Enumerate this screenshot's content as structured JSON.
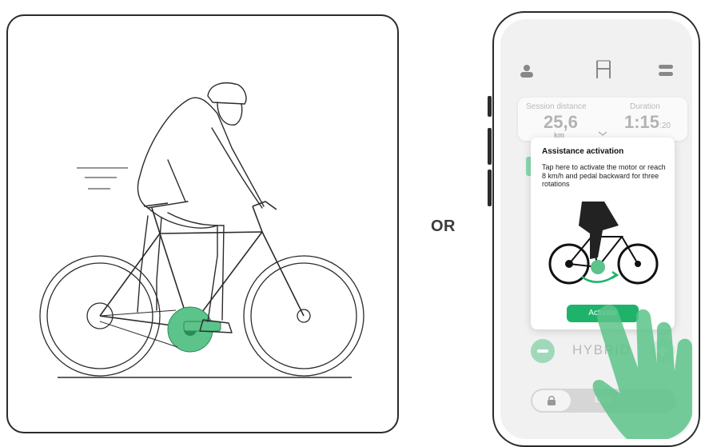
{
  "separator_text": "OR",
  "app": {
    "stats": [
      {
        "label": "Session distance",
        "value": "25,6",
        "unit": "km"
      },
      {
        "label": "Duration",
        "value": "1:15",
        "sub": ":20"
      }
    ],
    "popup": {
      "title": "Assistance activation",
      "body": "Tap here to activate the motor or reach 8 km/h and pedal backward for three rotations",
      "button": "Activate"
    },
    "mode": "HYBRID",
    "lock_label": "Lock"
  },
  "colors": {
    "accent": "#1fb26b",
    "accent_light": "#8bd8ae",
    "hand": "#5cc38a"
  }
}
